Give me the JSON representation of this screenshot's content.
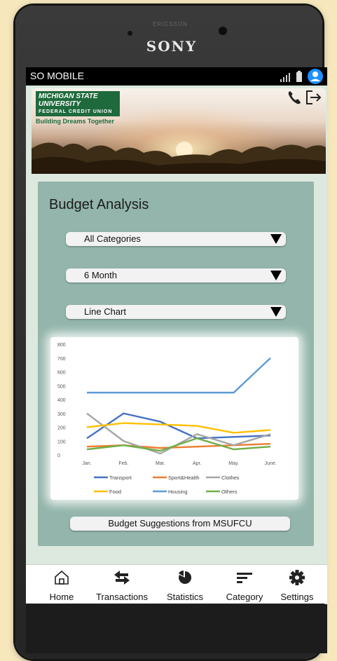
{
  "device": {
    "brand": "SONY",
    "earpiece_text": "ERICSSON"
  },
  "status_bar": {
    "title": "SO MOBILE"
  },
  "header": {
    "logo_text": "MICHIGAN STATE UNIVERSITY",
    "logo_sub": "FEDERAL CREDIT UNION",
    "tagline": "Building Dreams Together",
    "phone_icon": "phone-icon",
    "logout_icon": "logout-icon"
  },
  "panel": {
    "title": "Budget Analysis",
    "dropdowns": {
      "category": "All Categories",
      "period": "6 Month",
      "chart_type": "Line Chart"
    },
    "suggest_button": "Budget Suggestions from MSUFCU"
  },
  "chart_data": {
    "type": "line",
    "categories": [
      "Jan.",
      "Feb.",
      "Mar.",
      "Apr.",
      "May.",
      "June."
    ],
    "y_ticks": [
      "0",
      "100",
      "200",
      "300",
      "400",
      "500",
      "600",
      "700",
      "800"
    ],
    "ylim": [
      0,
      800
    ],
    "grid": false,
    "legend_position": "bottom",
    "series": [
      {
        "name": "Transport",
        "color": "#4472c4",
        "values": [
          120,
          300,
          240,
          120,
          130,
          140
        ]
      },
      {
        "name": "Sport&Health",
        "color": "#ed7d31",
        "values": [
          60,
          70,
          50,
          60,
          70,
          80
        ]
      },
      {
        "name": "Clothes",
        "color": "#a5a5a5",
        "values": [
          300,
          100,
          10,
          150,
          70,
          150
        ]
      },
      {
        "name": "Food",
        "color": "#ffc000",
        "values": [
          200,
          230,
          220,
          210,
          160,
          180
        ]
      },
      {
        "name": "Housing",
        "color": "#5b9bd5",
        "values": [
          450,
          450,
          450,
          450,
          450,
          700
        ]
      },
      {
        "name": "Others",
        "color": "#70ad47",
        "values": [
          40,
          70,
          30,
          120,
          40,
          60
        ]
      }
    ]
  },
  "nav": [
    {
      "label": "Home",
      "icon": "home-icon"
    },
    {
      "label": "Transactions",
      "icon": "transfer-icon"
    },
    {
      "label": "Statistics",
      "icon": "pie-chart-icon"
    },
    {
      "label": "Category",
      "icon": "sort-icon"
    },
    {
      "label": "Settings",
      "icon": "gear-icon"
    }
  ]
}
